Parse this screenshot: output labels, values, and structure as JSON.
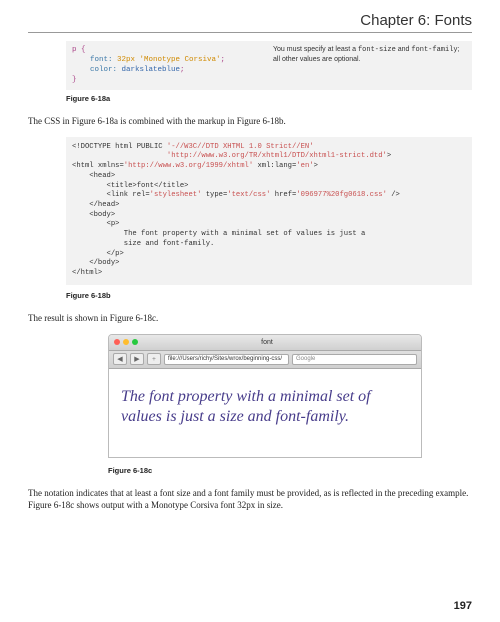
{
  "header": "Chapter 6: Fonts",
  "codeA": {
    "l1": "p {",
    "l2_k": "    font:",
    "l2_v": " 32px 'Monotype Corsiva'",
    "l2_s": ";",
    "l3_k": "    color:",
    "l3_v": " darkslateblue",
    "l3_s": ";",
    "l4": "}",
    "note_pre": "You must specify at least a ",
    "note_m1": "font-size",
    "note_mid": " and ",
    "note_m2": "font-family",
    "note_post": "; all other values are optional."
  },
  "captionA": "Figure 6-18a",
  "para1": "The CSS in Figure 6-18a is combined with the markup in Figure 6-18b.",
  "codeB": {
    "l1a": "<!DOCTYPE html PUBLIC ",
    "l1b": "'-//W3C//DTD XHTML 1.0 Strict//EN'",
    "l2": "                      'http://www.w3.org/TR/xhtml1/DTD/xhtml1-strict.dtd'",
    "l2end": ">",
    "l3a": "<html xmlns=",
    "l3b": "'http://www.w3.org/1999/xhtml'",
    "l3c": " xml:lang=",
    "l3d": "'en'",
    "l3e": ">",
    "l4": "    <head>",
    "l5a": "        <title>",
    "l5b": "font",
    "l5c": "</title>",
    "l6a": "        <link rel=",
    "l6b": "'stylesheet'",
    "l6c": " type=",
    "l6d": "'text/css'",
    "l6e": " href=",
    "l6f": "'096977%20fg0618.css'",
    "l6g": " />",
    "l7": "    </head>",
    "l8": "    <body>",
    "l9": "        <p>",
    "l10": "            The font property with a minimal set of values is just a",
    "l11": "            size and font-family.",
    "l12": "        </p>",
    "l13": "    </body>",
    "l14": "</html>"
  },
  "captionB": "Figure 6-18b",
  "para2": "The result is shown in Figure 6-18c.",
  "browser": {
    "title": "font",
    "nav_back": "◀",
    "nav_fwd": "▶",
    "plus": "+",
    "url": "file:///Users/richy/Sites/wrox/beginning-css/",
    "search_placeholder": "Google",
    "content": "The font property with a minimal set of values is just a size and font-family."
  },
  "captionC": "Figure 6-18c",
  "para3": "The notation indicates that at least a font size and a font family must be provided, as is reflected in the preceding example. Figure 6-18c shows output with a Monotype Corsiva font 32px in size.",
  "pageNumber": "197"
}
